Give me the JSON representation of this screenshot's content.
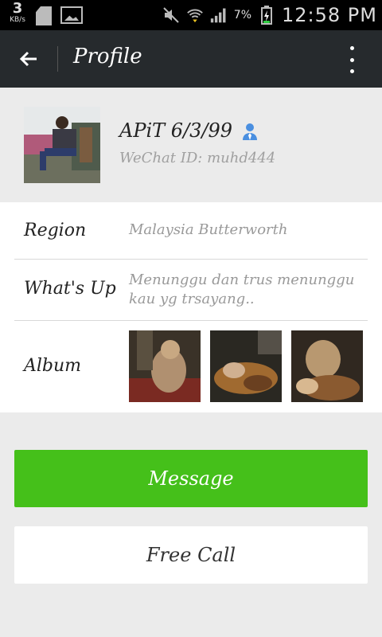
{
  "status_bar": {
    "speed_value": "3",
    "speed_unit": "KB/s",
    "battery": "7%",
    "time": "12:58 PM"
  },
  "app_bar": {
    "title": "Profile"
  },
  "profile": {
    "name": "APiT 6/3/99",
    "wechat_id": "WeChat ID: muhd444"
  },
  "details": [
    {
      "label": "Region",
      "value": "Malaysia  Butterworth"
    },
    {
      "label": "What's Up",
      "value": "Menunggu dan trus menunggu kau yg trsayang.."
    },
    {
      "label": "Album",
      "value": ""
    }
  ],
  "buttons": {
    "message": "Message",
    "free_call": "Free Call"
  },
  "colors": {
    "accent_green": "#45c01a",
    "app_bar": "#262a2d",
    "person_icon": "#4a8fe0"
  }
}
